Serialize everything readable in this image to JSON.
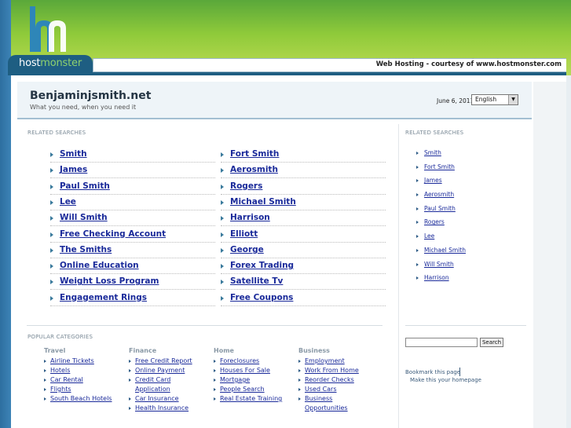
{
  "header": {
    "logo_host": "host",
    "logo_monster": "monster",
    "strip_text": "Web Hosting - courtesy of www.hostmonster.com"
  },
  "site": {
    "title": "Benjaminjsmith.net",
    "subtitle": "What you need, when you need it",
    "date": "June 6, 2011",
    "language": "English"
  },
  "related_label": "RELATED SEARCHES",
  "related_left": [
    "Smith",
    "James",
    "Paul Smith",
    "Lee",
    "Will Smith",
    "Free Checking Account",
    "The Smiths",
    "Online Education",
    "Weight Loss Program",
    "Engagement Rings"
  ],
  "related_right": [
    "Fort Smith",
    "Aerosmith",
    "Rogers",
    "Michael Smith",
    "Harrison",
    "Elliott",
    "George",
    "Forex Trading",
    "Satellite Tv",
    "Free Coupons"
  ],
  "popular_label": "POPULAR CATEGORIES",
  "categories": [
    {
      "head": "Travel",
      "items": [
        "Airline Tickets",
        "Hotels",
        "Car Rental",
        "Flights",
        "South Beach Hotels"
      ]
    },
    {
      "head": "Finance",
      "items": [
        "Free Credit Report",
        "Online Payment",
        "Credit Card Application",
        "Car Insurance",
        "Health Insurance"
      ]
    },
    {
      "head": "Home",
      "items": [
        "Foreclosures",
        "Houses For Sale",
        "Mortgage",
        "People Search",
        "Real Estate Training"
      ]
    },
    {
      "head": "Business",
      "items": [
        "Employment",
        "Work From Home",
        "Reorder Checks",
        "Used Cars",
        "Business Opportunities"
      ]
    }
  ],
  "sidebar": {
    "label": "RELATED SEARCHES",
    "items": [
      "Smith",
      "Fort Smith",
      "James",
      "Aerosmith",
      "Paul Smith",
      "Rogers",
      "Lee",
      "Michael Smith",
      "Will Smith",
      "Harrison"
    ],
    "search_button": "Search",
    "bookmark": "Bookmark this page",
    "homepage": "Make this your homepage"
  },
  "colors": {
    "header_green": "#8fca3a",
    "logo_blue": "#1e5e82",
    "link_blue": "#1a2a9a"
  }
}
